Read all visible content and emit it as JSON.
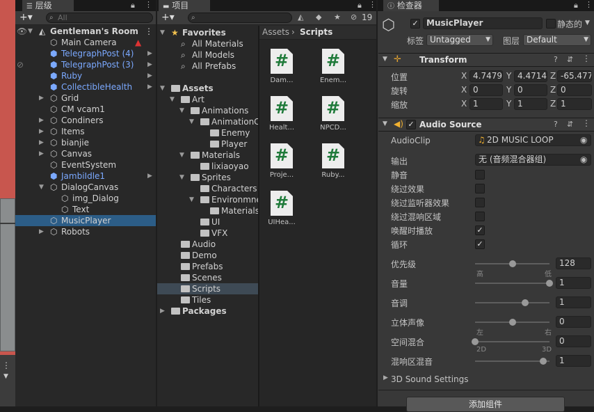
{
  "hierarchy": {
    "tab": "层级",
    "search_placeholder": "All",
    "items": [
      {
        "label": "Gentleman's Room",
        "color": "white",
        "indent": 0,
        "arrow": "down",
        "icon": "unity",
        "bold": true
      },
      {
        "label": "Main Camera",
        "color": "white",
        "indent": 1,
        "arrow": "",
        "icon": "cube"
      },
      {
        "label": "TelegraphPost (4)",
        "color": "blue",
        "indent": 1,
        "arrow": "",
        "icon": "prefab"
      },
      {
        "label": "TelegraphPost (3)",
        "color": "blue",
        "indent": 1,
        "arrow": "",
        "icon": "prefab"
      },
      {
        "label": "Ruby",
        "color": "blue",
        "indent": 1,
        "arrow": "",
        "icon": "prefab"
      },
      {
        "label": "CollectibleHealth",
        "color": "blue",
        "indent": 1,
        "arrow": "",
        "icon": "prefab"
      },
      {
        "label": "Grid",
        "color": "white",
        "indent": 1,
        "arrow": "right",
        "icon": "cube"
      },
      {
        "label": "CM vcam1",
        "color": "white",
        "indent": 1,
        "arrow": "",
        "icon": "cube"
      },
      {
        "label": "Condiners",
        "color": "white",
        "indent": 1,
        "arrow": "right",
        "icon": "cube"
      },
      {
        "label": "Items",
        "color": "white",
        "indent": 1,
        "arrow": "right",
        "icon": "cube"
      },
      {
        "label": "bianjie",
        "color": "white",
        "indent": 1,
        "arrow": "right",
        "icon": "cube"
      },
      {
        "label": "Canvas",
        "color": "white",
        "indent": 1,
        "arrow": "right",
        "icon": "cube"
      },
      {
        "label": "EventSystem",
        "color": "white",
        "indent": 1,
        "arrow": "",
        "icon": "cube"
      },
      {
        "label": "JambiIdle1",
        "color": "blue",
        "indent": 1,
        "arrow": "",
        "icon": "prefab"
      },
      {
        "label": "DialogCanvas",
        "color": "white",
        "indent": 1,
        "arrow": "down",
        "icon": "cube"
      },
      {
        "label": "img_Dialog",
        "color": "white",
        "indent": 2,
        "arrow": "",
        "icon": "cube"
      },
      {
        "label": "Text",
        "color": "white",
        "indent": 2,
        "arrow": "",
        "icon": "cube"
      },
      {
        "label": "MusicPlayer",
        "color": "white",
        "indent": 1,
        "arrow": "",
        "icon": "cube",
        "selected": true
      },
      {
        "label": "Robots",
        "color": "white",
        "indent": 1,
        "arrow": "right",
        "icon": "cube"
      }
    ]
  },
  "project": {
    "tab": "项目",
    "hidden_count": "19",
    "breadcrumb": [
      "Assets",
      "Scripts"
    ],
    "tree": [
      {
        "label": "Favorites",
        "indent": 0,
        "arrow": "down",
        "icon": "star",
        "bold": true
      },
      {
        "label": "All Materials",
        "indent": 1,
        "arrow": "",
        "icon": "search"
      },
      {
        "label": "All Models",
        "indent": 1,
        "arrow": "",
        "icon": "search"
      },
      {
        "label": "All Prefabs",
        "indent": 1,
        "arrow": "",
        "icon": "search"
      },
      {
        "label": "",
        "indent": 0,
        "arrow": "",
        "icon": ""
      },
      {
        "label": "Assets",
        "indent": 0,
        "arrow": "down",
        "icon": "folder",
        "bold": true
      },
      {
        "label": "Art",
        "indent": 1,
        "arrow": "down",
        "icon": "folder"
      },
      {
        "label": "Animations",
        "indent": 2,
        "arrow": "down",
        "icon": "folder"
      },
      {
        "label": "AnimationCl",
        "indent": 3,
        "arrow": "down",
        "icon": "folder"
      },
      {
        "label": "Enemy",
        "indent": 4,
        "arrow": "",
        "icon": "folder"
      },
      {
        "label": "Player",
        "indent": 4,
        "arrow": "",
        "icon": "folder"
      },
      {
        "label": "Materials",
        "indent": 2,
        "arrow": "down",
        "icon": "folder"
      },
      {
        "label": "lixiaoyao",
        "indent": 3,
        "arrow": "",
        "icon": "folder"
      },
      {
        "label": "Sprites",
        "indent": 2,
        "arrow": "down",
        "icon": "folder"
      },
      {
        "label": "Characters",
        "indent": 3,
        "arrow": "",
        "icon": "folder"
      },
      {
        "label": "Environmne",
        "indent": 3,
        "arrow": "down",
        "icon": "folder"
      },
      {
        "label": "Materials",
        "indent": 4,
        "arrow": "",
        "icon": "folder"
      },
      {
        "label": "UI",
        "indent": 3,
        "arrow": "",
        "icon": "folder"
      },
      {
        "label": "VFX",
        "indent": 3,
        "arrow": "",
        "icon": "folder"
      },
      {
        "label": "Audio",
        "indent": 1,
        "arrow": "",
        "icon": "folder"
      },
      {
        "label": "Demo",
        "indent": 1,
        "arrow": "",
        "icon": "folder"
      },
      {
        "label": "Prefabs",
        "indent": 1,
        "arrow": "",
        "icon": "folder"
      },
      {
        "label": "Scenes",
        "indent": 1,
        "arrow": "",
        "icon": "folder"
      },
      {
        "label": "Scripts",
        "indent": 1,
        "arrow": "",
        "icon": "folder",
        "selected": true
      },
      {
        "label": "Tiles",
        "indent": 1,
        "arrow": "",
        "icon": "folder"
      },
      {
        "label": "Packages",
        "indent": 0,
        "arrow": "right",
        "icon": "folder",
        "bold": true
      }
    ],
    "files": [
      "Dam...",
      "Enem...",
      "Healt...",
      "NPCD...",
      "Proje...",
      "Ruby...",
      "UIHea..."
    ]
  },
  "inspector": {
    "tab": "检查器",
    "object_name": "MusicPlayer",
    "static_label": "静态的",
    "tag_label": "标签",
    "tag_value": "Untagged",
    "layer_label": "图层",
    "layer_value": "Default",
    "transform": {
      "title": "Transform",
      "rows": [
        {
          "label": "位置",
          "x": "4.74796",
          "y": "4.47146",
          "z": "-65.477"
        },
        {
          "label": "旋转",
          "x": "0",
          "y": "0",
          "z": "0"
        },
        {
          "label": "缩放",
          "x": "1",
          "y": "1",
          "z": "1"
        }
      ]
    },
    "audio": {
      "title": "Audio Source",
      "clip_label": "AudioClip",
      "clip_value": "2D MUSIC LOOP",
      "output_label": "输出",
      "output_value": "无 (音频混合器组)",
      "toggles": [
        {
          "label": "静音",
          "checked": false
        },
        {
          "label": "绕过效果",
          "checked": false
        },
        {
          "label": "绕过监听器效果",
          "checked": false
        },
        {
          "label": "绕过混响区域",
          "checked": false
        },
        {
          "label": "唤醒时播放",
          "checked": true
        },
        {
          "label": "循环",
          "checked": true
        }
      ],
      "sliders": [
        {
          "label": "优先级",
          "value": "128",
          "fraction": 0.5,
          "min_label": "高",
          "max_label": "低"
        },
        {
          "label": "音量",
          "value": "1",
          "fraction": 1.0,
          "min_label": "",
          "max_label": ""
        },
        {
          "label": "音调",
          "value": "1",
          "fraction": 0.67,
          "min_label": "",
          "max_label": ""
        },
        {
          "label": "立体声像",
          "value": "0",
          "fraction": 0.5,
          "min_label": "左",
          "max_label": "右"
        },
        {
          "label": "空间混合",
          "value": "0",
          "fraction": 0.0,
          "min_label": "2D",
          "max_label": "3D"
        },
        {
          "label": "混响区混音",
          "value": "1",
          "fraction": 0.92,
          "min_label": "",
          "max_label": ""
        }
      ],
      "sound3d_label": "3D Sound Settings"
    },
    "add_component": "添加组件"
  }
}
